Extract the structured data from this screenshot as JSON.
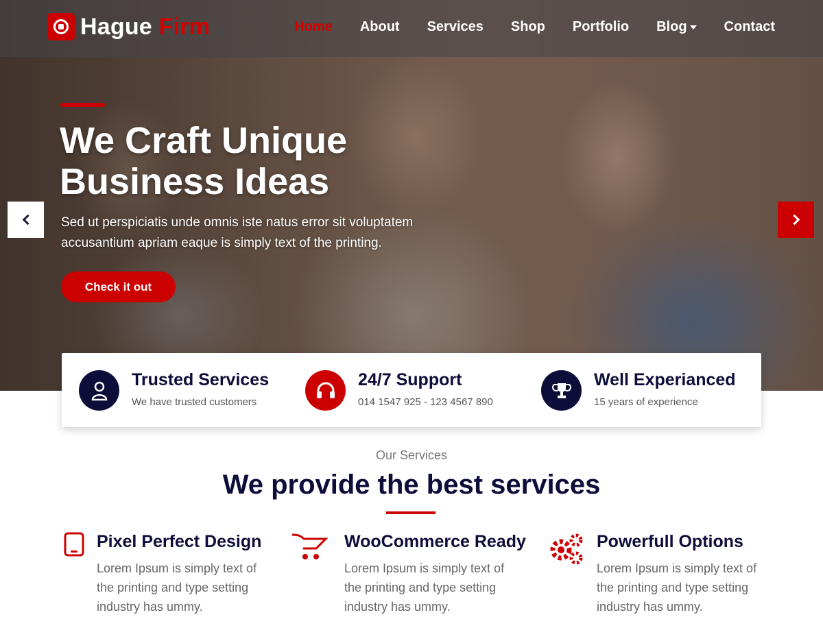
{
  "brand": {
    "name_part1": "Hague",
    "name_part2": "Firm"
  },
  "nav": {
    "items": [
      {
        "label": "Home"
      },
      {
        "label": "About"
      },
      {
        "label": "Services"
      },
      {
        "label": "Shop"
      },
      {
        "label": "Portfolio"
      },
      {
        "label": "Blog"
      },
      {
        "label": "Contact"
      }
    ]
  },
  "hero": {
    "title_line1": "We Craft Unique",
    "title_line2": "Business Ideas",
    "description": "Sed ut perspiciatis unde omnis iste natus error sit voluptatem accusantium apriam eaque is simply text of the printing.",
    "button_label": "Check it out"
  },
  "features": [
    {
      "title": "Trusted Services",
      "subtitle": "We have trusted customers",
      "icon": "user-icon"
    },
    {
      "title": "24/7 Support",
      "subtitle": "014 1547 925 - 123 4567 890",
      "icon": "headphones-icon"
    },
    {
      "title": "Well Experianced",
      "subtitle": "15 years of experience",
      "icon": "trophy-icon"
    }
  ],
  "services": {
    "eyebrow": "Our Services",
    "title_bold": "We provide the",
    "title_rest": "best services",
    "items": [
      {
        "title": "Pixel Perfect Design",
        "text": "Lorem Ipsum is simply text of the printing and type setting industry has ummy.",
        "icon": "tablet-icon"
      },
      {
        "title": "WooCommerce Ready",
        "text": "Lorem Ipsum is simply text of the printing and type setting industry has ummy.",
        "icon": "cart-icon"
      },
      {
        "title": "Powerfull Options",
        "text": "Lorem Ipsum is simply text of the printing and type setting industry has ummy.",
        "icon": "gears-icon"
      }
    ]
  },
  "colors": {
    "accent": "#cc0000",
    "navy": "#0d0d3a"
  }
}
